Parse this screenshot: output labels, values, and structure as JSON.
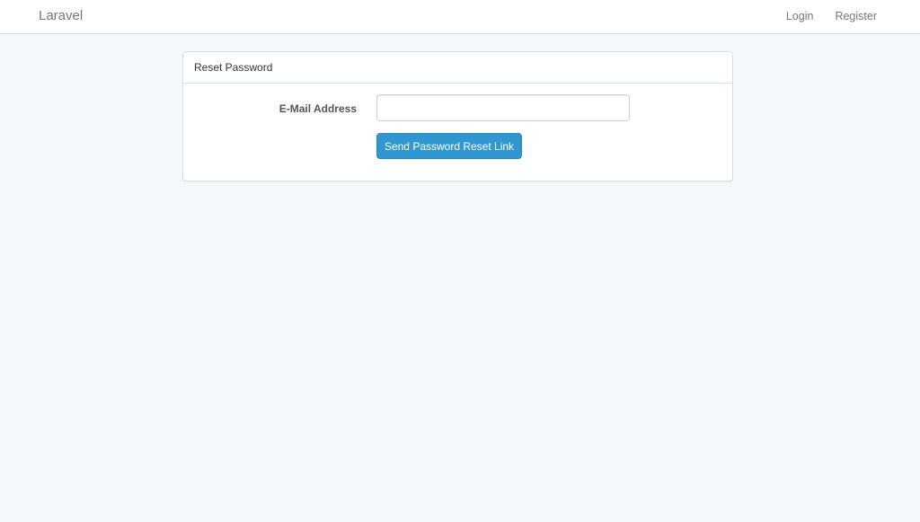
{
  "navbar": {
    "brand": "Laravel",
    "links": [
      {
        "label": "Login"
      },
      {
        "label": "Register"
      }
    ]
  },
  "panel": {
    "heading": "Reset Password",
    "email_label": "E-Mail Address",
    "email_value": "",
    "submit_label": "Send Password Reset Link"
  },
  "colors": {
    "page_background": "#f5f8fa",
    "button_primary": "#3097d1",
    "border": "#d3e0e9"
  }
}
